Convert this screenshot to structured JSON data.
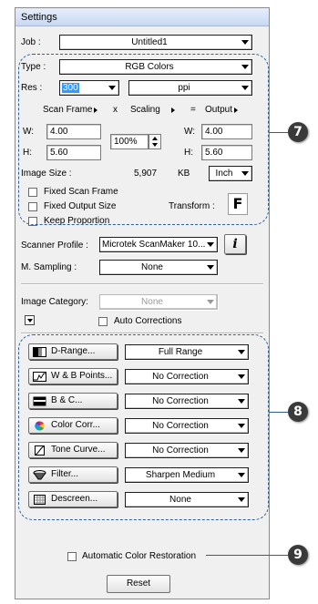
{
  "window": {
    "title": "Settings"
  },
  "job": {
    "label": "Job :",
    "value": "Untitled1"
  },
  "type": {
    "label": "Type :",
    "value": "RGB Colors"
  },
  "res": {
    "label": "Res :",
    "value": "300",
    "unit": "ppi"
  },
  "scan": {
    "scan_frame": "Scan Frame",
    "x": "x",
    "scaling": "Scaling",
    "eq": "=",
    "output": "Output",
    "w_label": "W:",
    "h_label": "H:",
    "scan_w": "4.00",
    "scan_h": "5.60",
    "scaling_value": "100%",
    "out_w": "4.00",
    "out_h": "5.60"
  },
  "image_size": {
    "label": "Image Size :",
    "value": "5,907",
    "unit": "KB",
    "dim_unit": "Inch"
  },
  "checks": {
    "fixed_scan_frame": "Fixed Scan Frame",
    "fixed_output_size": "Fixed Output Size",
    "keep_proportion": "Keep Proportion"
  },
  "transform": {
    "label": "Transform :",
    "button": "F"
  },
  "scanner_profile": {
    "label": "Scanner Profile :",
    "value": "Microtek ScanMaker 10...",
    "info_button": "i"
  },
  "m_sampling": {
    "label": "M. Sampling :",
    "value": "None"
  },
  "image_category": {
    "label": "Image Category:",
    "value": "None"
  },
  "auto_corrections": {
    "label": "Auto Corrections"
  },
  "adjustments": [
    {
      "button": "D-Range...",
      "value": "Full Range",
      "icon": "d-range-icon"
    },
    {
      "button": "W & B Points...",
      "value": "No Correction",
      "icon": "white-black-points-icon"
    },
    {
      "button": "B & C...",
      "value": "No Correction",
      "icon": "brightness-contrast-icon"
    },
    {
      "button": "Color Corr...",
      "value": "No Correction",
      "icon": "color-wheel-icon"
    },
    {
      "button": "Tone Curve...",
      "value": "No Correction",
      "icon": "tone-curve-icon"
    },
    {
      "button": "Filter...",
      "value": "Sharpen Medium",
      "icon": "filter-icon"
    },
    {
      "button": "Descreen...",
      "value": "None",
      "icon": "descreen-icon"
    }
  ],
  "auto_color_restoration": {
    "label": "Automatic Color Restoration"
  },
  "reset": {
    "label": "Reset"
  },
  "callouts": {
    "first": "7",
    "second": "8",
    "third": "9"
  },
  "colors": {
    "callout_line": "#2f5e9f",
    "panel_bg": "#f0f0f0",
    "res_highlight": "#3399ff"
  }
}
